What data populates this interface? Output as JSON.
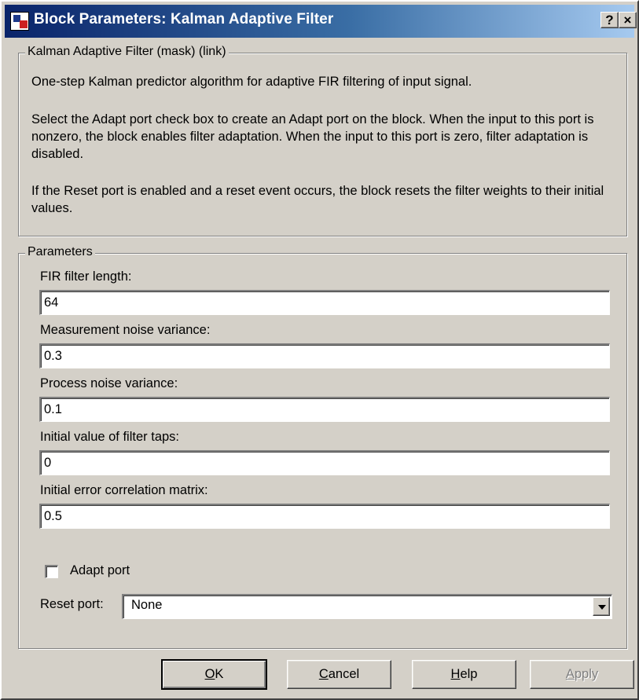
{
  "window": {
    "title": "Block Parameters: Kalman Adaptive Filter",
    "caption_help": "?",
    "caption_close": "×"
  },
  "description": {
    "legend": "Kalman Adaptive Filter (mask) (link)",
    "paragraphs": [
      "One-step Kalman predictor algorithm for adaptive FIR filtering of input signal.",
      "Select the Adapt port check box to create an Adapt port on the block. When the input to this port is nonzero, the block enables filter adaptation. When the input to this port is zero, filter adaptation is disabled.",
      "If the Reset port is enabled and a reset event occurs, the block resets the filter weights to their initial values."
    ]
  },
  "parameters": {
    "legend": "Parameters",
    "fields": [
      {
        "label": "FIR filter length:",
        "value": "64"
      },
      {
        "label": "Measurement noise variance:",
        "value": "0.3"
      },
      {
        "label": "Process noise variance:",
        "value": "0.1"
      },
      {
        "label": "Initial value of filter taps:",
        "value": "0"
      },
      {
        "label": "Initial error correlation matrix:",
        "value": "0.5"
      }
    ],
    "adapt_port": {
      "label": "Adapt port",
      "checked": false
    },
    "reset_port": {
      "label": "Reset port:",
      "value": "None"
    }
  },
  "buttons": {
    "ok": {
      "mnemonic": "O",
      "rest": "K"
    },
    "cancel": {
      "mnemonic": "C",
      "rest": "ancel"
    },
    "help": {
      "mnemonic": "H",
      "rest": "elp"
    },
    "apply": {
      "mnemonic": "A",
      "rest": "pply"
    }
  },
  "colors": {
    "title_gradient_start": "#0a246a",
    "title_gradient_end": "#a6caf0",
    "face": "#d4d0c8"
  }
}
